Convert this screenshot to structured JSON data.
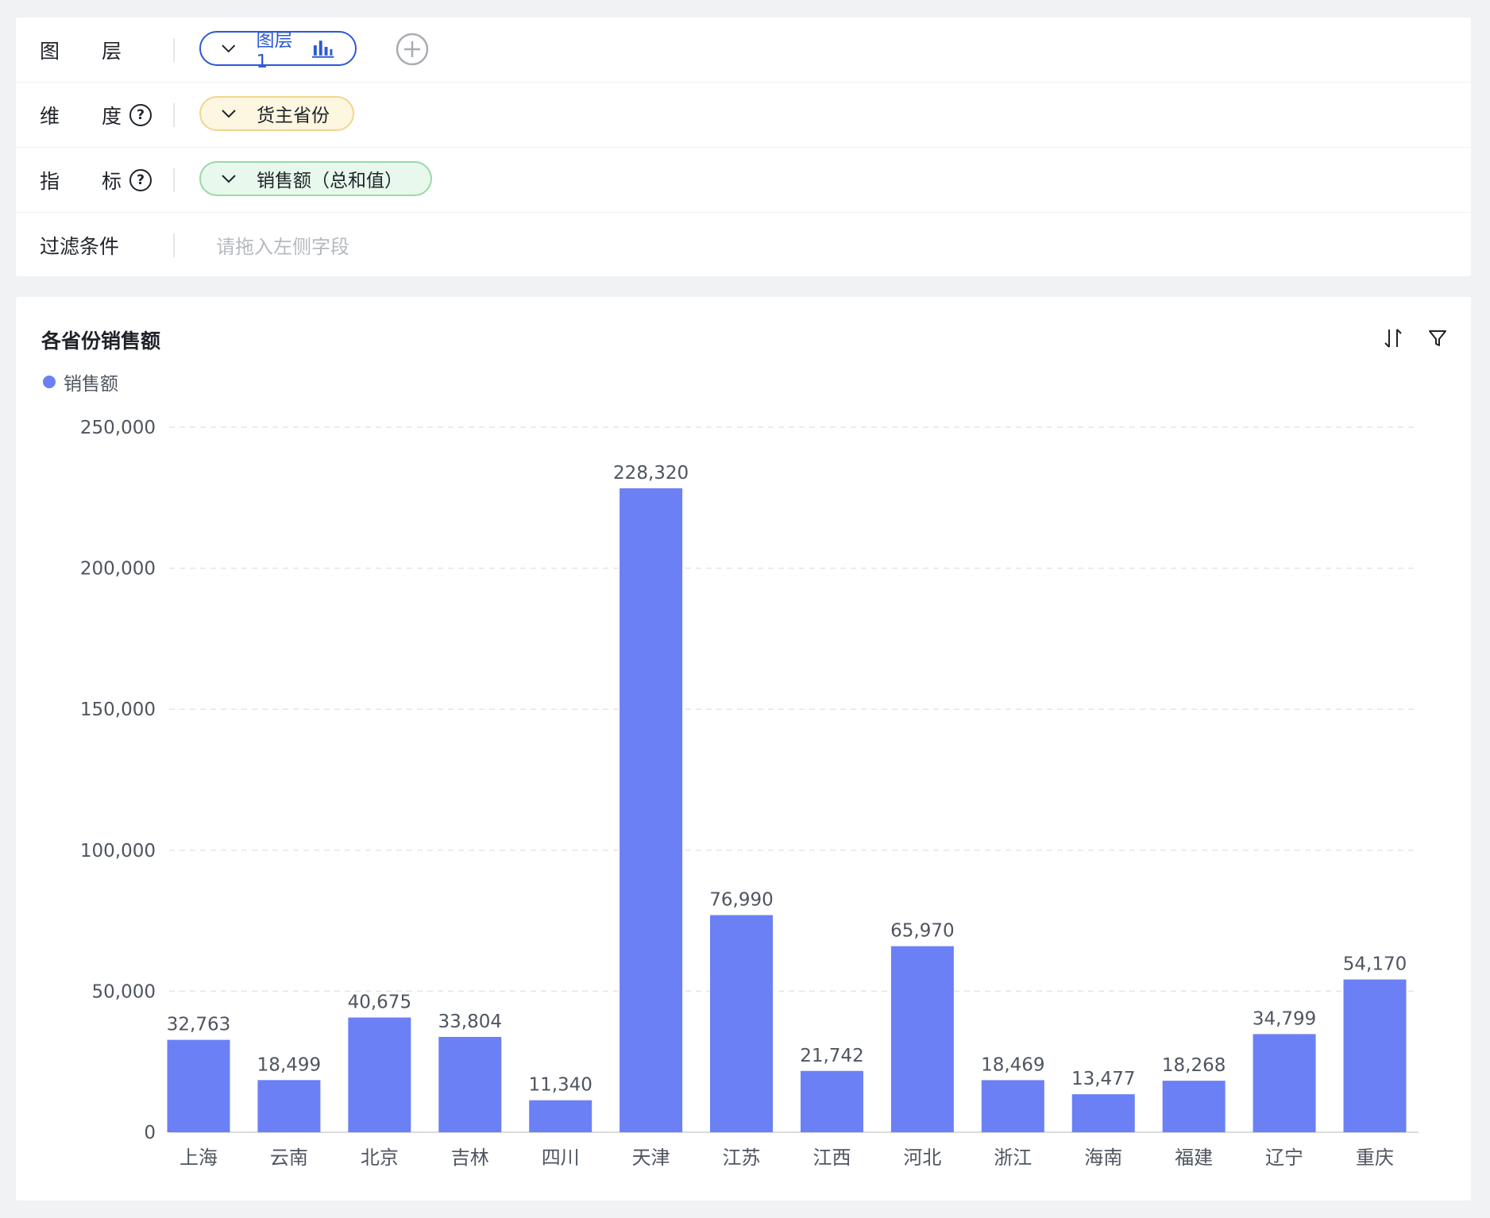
{
  "config": {
    "layer": {
      "label_c1": "图",
      "label_c2": "层",
      "pill_text": "图层1"
    },
    "dimension": {
      "label_c1": "维",
      "label_c2": "度",
      "help": "?",
      "pill_text": "货主省份"
    },
    "metric": {
      "label_c1": "指",
      "label_c2": "标",
      "help": "?",
      "pill_text": "销售额（总和值）"
    },
    "filter": {
      "label": "过滤条件",
      "placeholder": "请拖入左侧字段"
    }
  },
  "colors": {
    "bar": "#6b80f4",
    "layer_accent": "#2b58d8"
  },
  "chart_data": {
    "type": "bar",
    "title": "各省份销售额",
    "categories": [
      "上海",
      "云南",
      "北京",
      "吉林",
      "四川",
      "天津",
      "江苏",
      "江西",
      "河北",
      "浙江",
      "海南",
      "福建",
      "辽宁",
      "重庆"
    ],
    "series": [
      {
        "name": "销售额",
        "values": [
          32763,
          18499,
          40675,
          33804,
          11340,
          228320,
          76990,
          21742,
          65970,
          18469,
          13477,
          18268,
          34799,
          54170
        ]
      }
    ],
    "value_labels": [
      "32,763",
      "18,499",
      "40,675",
      "33,804",
      "11,340",
      "228,320",
      "76,990",
      "21,742",
      "65,970",
      "18,469",
      "13,477",
      "18,268",
      "34,799",
      "54,170"
    ],
    "y_ticks": [
      0,
      50000,
      100000,
      150000,
      200000,
      250000
    ],
    "y_tick_labels": [
      "0",
      "50,000",
      "100,000",
      "150,000",
      "200,000",
      "250,000"
    ],
    "ylim": [
      0,
      250000
    ],
    "grid": true,
    "legend": "top-left"
  }
}
